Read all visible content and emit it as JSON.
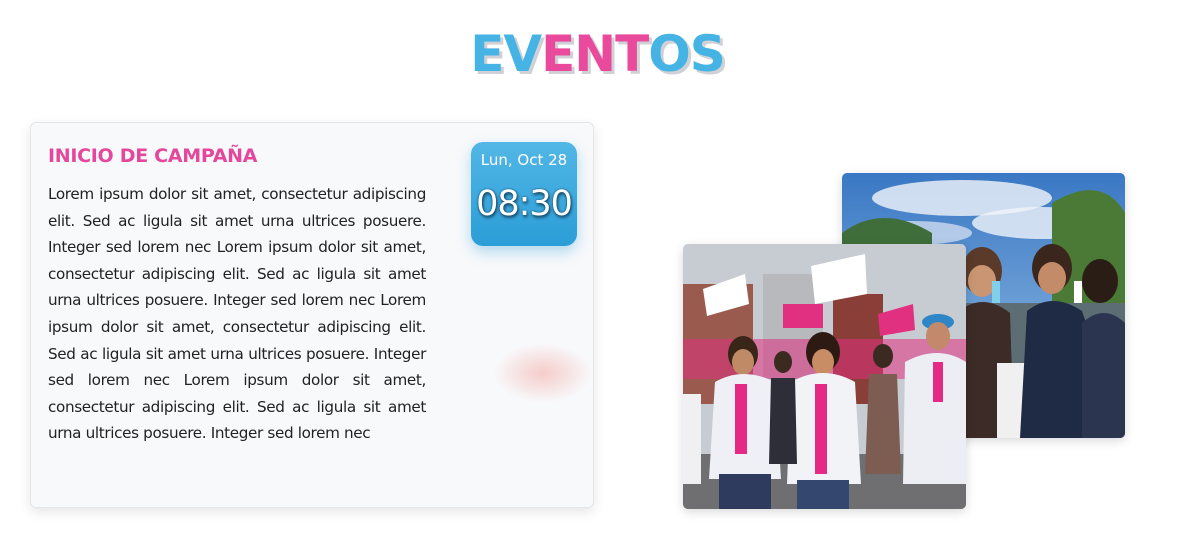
{
  "section": {
    "title_part1": "EV",
    "title_part2": "ENT",
    "title_part3": "OS"
  },
  "event": {
    "title": "INICIO DE CAMPAÑA",
    "description": "Lorem ipsum dolor sit amet, consectetur adipiscing elit. Sed ac ligula sit amet urna ultrices posuere. Integer sed lorem nec Lorem ipsum dolor sit amet, consectetur adipiscing elit. Sed ac ligula sit amet urna ultrices posuere. Integer sed lorem nec Lorem ipsum dolor sit amet, consectetur adipiscing elit. Sed ac ligula sit amet urna ultrices posuere. Integer sed lorem nec Lorem ipsum dolor sit amet, consectetur adipiscing elit. Sed ac ligula sit amet urna ultrices posuere. Integer sed lorem nec",
    "date": "Lun, Oct 28",
    "time": "08:30"
  },
  "colors": {
    "brand_blue": "#45b4e4",
    "brand_pink": "#e94a9c",
    "badge_blue": "#2b9dd7"
  },
  "photos": {
    "back": "group-selfie-photo",
    "front": "campaign-march-photo"
  }
}
